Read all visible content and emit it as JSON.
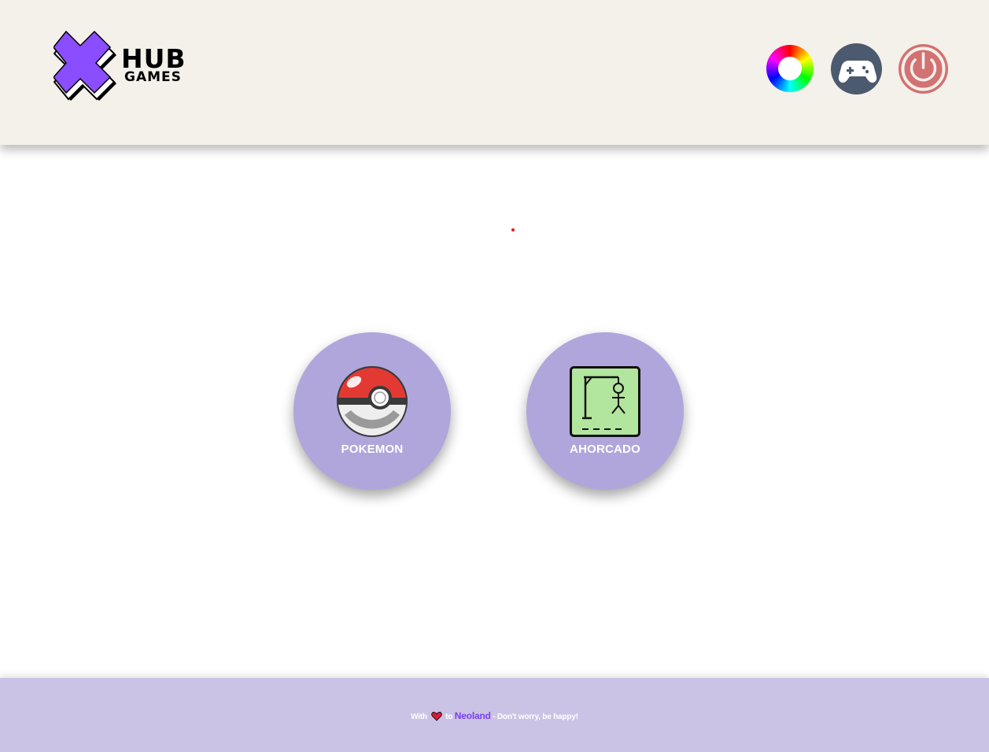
{
  "header": {
    "logo": {
      "line1": "HUB",
      "line2": "GAMES"
    },
    "buttons": [
      {
        "name": "color-wheel-button",
        "icon": "color-wheel-icon"
      },
      {
        "name": "games-button",
        "icon": "gamepad-icon",
        "color": "#4b5a6f"
      },
      {
        "name": "logout-button",
        "icon": "power-icon",
        "color": "#d27272"
      }
    ]
  },
  "games": [
    {
      "label": "POKEMON",
      "icon": "pokeball-icon"
    },
    {
      "label": "AHORCADO",
      "icon": "hangman-icon"
    }
  ],
  "footer": {
    "prefix": "With",
    "icon": "heart-icon",
    "middle": "to",
    "brand": "Neoland",
    "suffix": "- Don't worry, be happy!"
  },
  "colors": {
    "header_bg": "#f4f0ea",
    "card_bg": "#b0a6db",
    "footer_bg": "#cbc3e5",
    "brand_accent": "#7a3ff1"
  }
}
